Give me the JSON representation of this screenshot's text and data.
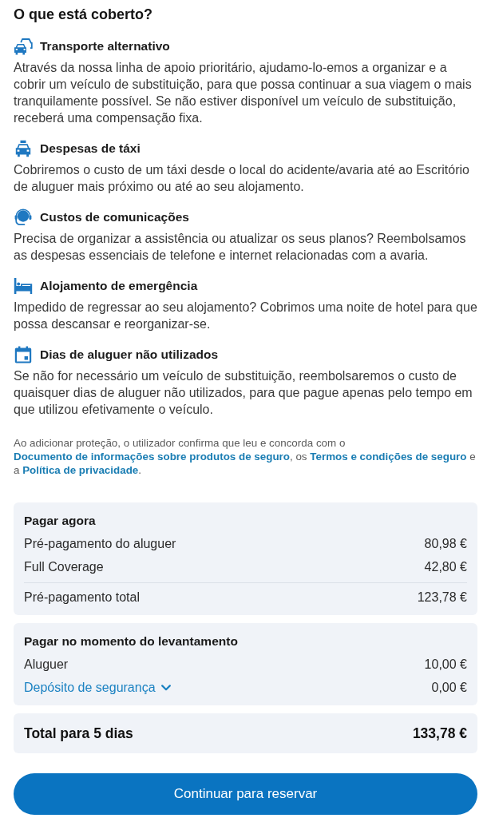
{
  "heading": "O que está coberto?",
  "benefits": [
    {
      "title": "Transporte alternativo",
      "text": "Através da nossa linha de apoio prioritário, ajudamo-lo-emos a organizar e a cobrir um veículo de substituição, para que possa continuar a sua viagem o mais tranquilamente possível. Se não estiver disponível um veículo de substituição, receberá uma compensação fixa."
    },
    {
      "title": "Despesas de táxi",
      "text": "Cobriremos o custo de um táxi desde o local do acidente/avaria até ao Escritório de aluguer mais próximo ou até ao seu alojamento."
    },
    {
      "title": "Custos de comunicações",
      "text": "Precisa de organizar a assistência ou atualizar os seus planos? Reembolsamos as despesas essenciais de telefone e internet relacionadas com a avaria."
    },
    {
      "title": "Alojamento de emergência",
      "text": "Impedido de regressar ao seu alojamento? Cobrimos uma noite de hotel para que possa descansar e reorganizar-se."
    },
    {
      "title": "Dias de aluguer não utilizados",
      "text": "Se não for necessário um veículo de substituição, reembolsaremos o custo de quaisquer dias de aluguer não utilizados, para que pague apenas pelo tempo em que utilizou efetivamente o veículo."
    }
  ],
  "legal": [
    {
      "kind": "text",
      "text": "Ao adicionar proteção, o utilizador confirma que leu e concorda com o "
    },
    {
      "kind": "link",
      "text": "Documento de informações sobre produtos de seguro"
    },
    {
      "kind": "text",
      "text": ", os "
    },
    {
      "kind": "link",
      "text": "Termos e condições de seguro"
    },
    {
      "kind": "text",
      "text": " e a "
    },
    {
      "kind": "link",
      "text": "Política de privacidade"
    },
    {
      "kind": "text",
      "text": "."
    }
  ],
  "pay_now": {
    "title": "Pagar agora",
    "rows": [
      {
        "label": "Pré-pagamento do aluguer",
        "amount": "80,98 €"
      },
      {
        "label": "Full Coverage",
        "amount": "42,80 €"
      }
    ],
    "total": {
      "label": "Pré-pagamento total",
      "amount": "123,78 €"
    }
  },
  "pay_at_pickup": {
    "title": "Pagar no momento do levantamento",
    "rows": [
      {
        "label": "Aluguer",
        "amount": "10,00 €"
      }
    ],
    "deposit": {
      "label": "Depósito de segurança",
      "amount": "0,00 €",
      "expanded": false
    }
  },
  "grand_total": {
    "label": "Total para 5 dias",
    "amount": "133,78 €"
  },
  "continue_button": {
    "label": "Continuar para reservar"
  }
}
